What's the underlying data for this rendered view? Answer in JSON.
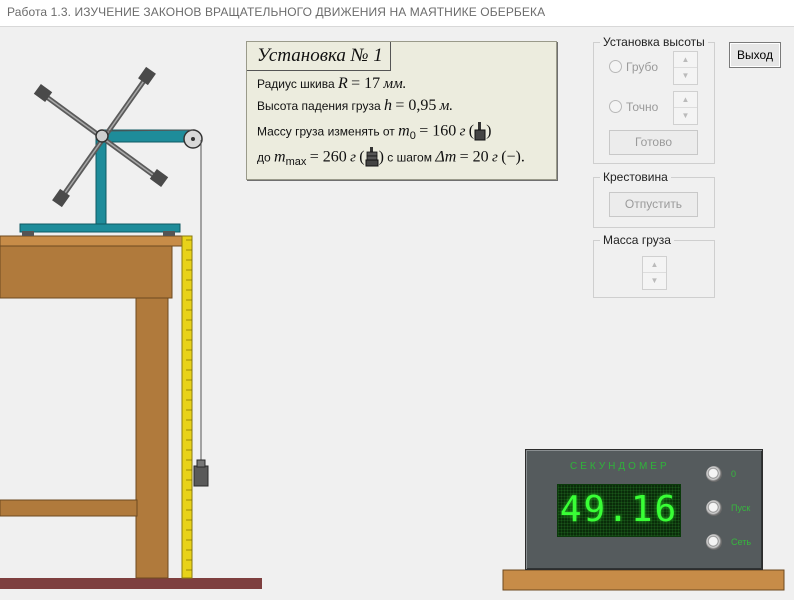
{
  "window": {
    "title": "Работа 1.3. ИЗУЧЕНИЕ ЗАКОНОВ ВРАЩАТЕЛЬНОГО ДВИЖЕНИЯ НА МАЯТНИКЕ ОБЕРБЕКА"
  },
  "card": {
    "title": "Установка № 1",
    "radius_label": "Радиус шкива",
    "radius_var": "R",
    "radius_value": "= 17",
    "radius_unit": "мм.",
    "height_label": "Высота падения груза",
    "height_var": "h",
    "height_value": "= 0,95",
    "height_unit": "м.",
    "mass_from_label": "Массу груза изменять от",
    "m0_var": "m",
    "m0_sub": "0",
    "m0_value": "= 160",
    "mass_unit": "г",
    "to_label": "до",
    "mmax_var": "m",
    "mmax_sub": "max",
    "mmax_value": "= 260",
    "step_label": "с шагом",
    "step_var": "Δm",
    "step_value": "= 20",
    "paren_open": "(",
    "paren_close": ")",
    "minus_sign": "−",
    "close_tail": ")."
  },
  "height_group": {
    "title": "Установка высоты",
    "coarse_label": "Грубо",
    "fine_label": "Точно",
    "done_label": "Готово",
    "up_arrow": "▲",
    "down_arrow": "▼"
  },
  "cross_group": {
    "title": "Крестовина",
    "release_label": "Отпустить"
  },
  "mass_group": {
    "title": "Масса груза"
  },
  "exit_label": "Выход",
  "stopwatch": {
    "title": "СЕКУНДОМЕР",
    "value": "49.16",
    "buttons": [
      {
        "label": "0"
      },
      {
        "label": "Пуск"
      },
      {
        "label": "Сеть"
      }
    ]
  },
  "colors": {
    "wood": "#b07a3c",
    "wood_light": "#c78c48",
    "teal_frame": "#1e8c9a",
    "ruler": "#e8d21a",
    "floor": "#7e3f3f",
    "display_text": "#39ff36"
  }
}
